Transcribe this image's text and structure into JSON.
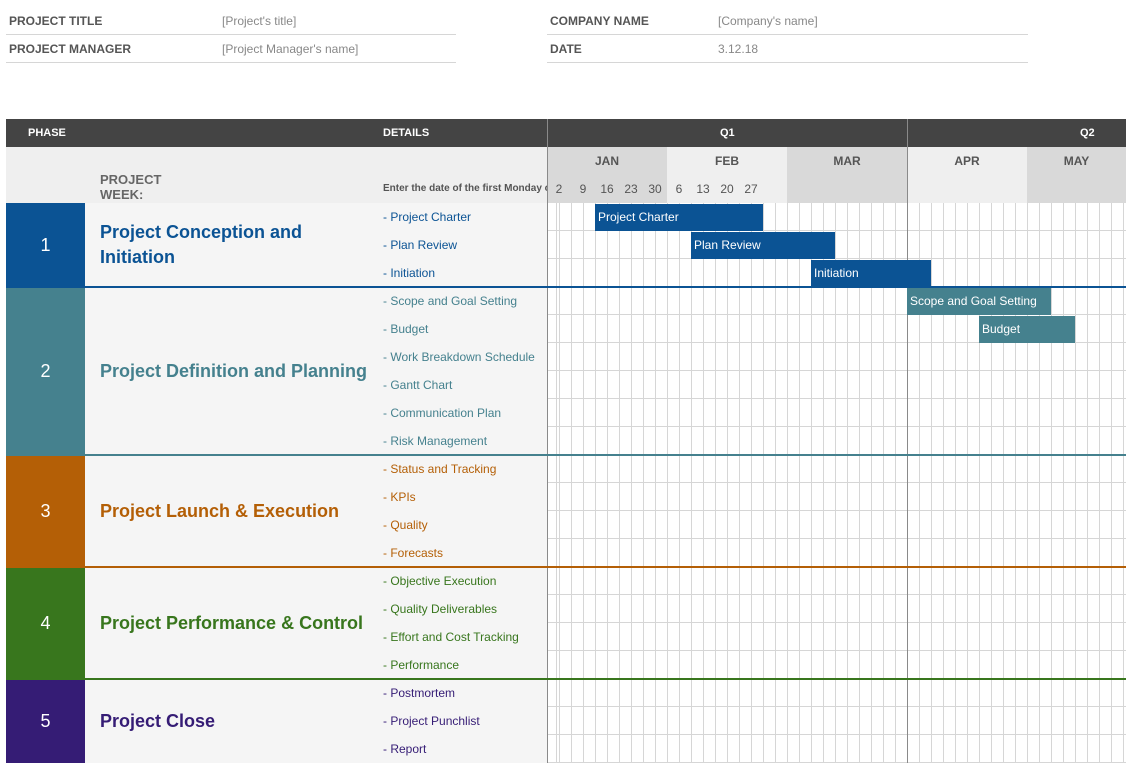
{
  "header": {
    "project_title_label": "PROJECT TITLE",
    "project_title_value": "[Project's title]",
    "project_manager_label": "PROJECT MANAGER",
    "project_manager_value": "[Project Manager's name]",
    "company_name_label": "COMPANY NAME",
    "company_name_value": "[Company's name]",
    "date_label": "DATE",
    "date_value": "3.12.18"
  },
  "table": {
    "phase_header": "PHASE",
    "details_header": "DETAILS",
    "quarters": [
      "Q1",
      "Q2"
    ],
    "months": [
      "JAN",
      "FEB",
      "MAR",
      "APR",
      "MAY"
    ],
    "project_week_label": "PROJECT WEEK:",
    "first_monday_label": "Enter the date of the first Monday of each month",
    "weeks": [
      "2",
      "9",
      "16",
      "23",
      "30",
      "6",
      "13",
      "20",
      "27"
    ]
  },
  "phases": [
    {
      "number": "1",
      "title": "Project Conception and Initiation",
      "color": "#0b5394",
      "details": [
        "- Project Charter",
        "- Plan Review",
        "- Initiation"
      ]
    },
    {
      "number": "2",
      "title": "Project Definition and Planning",
      "color": "#45818e",
      "details": [
        "- Scope and Goal Setting",
        "- Budget",
        "- Work Breakdown Schedule",
        "- Gantt Chart",
        "- Communication Plan",
        "- Risk Management"
      ]
    },
    {
      "number": "3",
      "title": "Project Launch & Execution",
      "color": "#b45f06",
      "details": [
        "- Status and Tracking",
        "- KPIs",
        "- Quality",
        "- Forecasts"
      ]
    },
    {
      "number": "4",
      "title": "Project Performance & Control",
      "color": "#38761d",
      "details": [
        "- Objective Execution",
        "- Quality Deliverables",
        "- Effort and Cost Tracking",
        "- Performance"
      ]
    },
    {
      "number": "5",
      "title": "Project Close",
      "color": "#351c75",
      "details": [
        "- Postmortem",
        "- Project Punchlist",
        "- Report"
      ]
    }
  ],
  "gantt_bars": [
    {
      "label": "Project Charter",
      "color": "#0b5394"
    },
    {
      "label": "Plan Review",
      "color": "#0b5394"
    },
    {
      "label": "Initiation",
      "color": "#0b5394"
    },
    {
      "label": "Scope and Goal Setting",
      "color": "#45818e"
    },
    {
      "label": "Budget",
      "color": "#45818e"
    }
  ]
}
